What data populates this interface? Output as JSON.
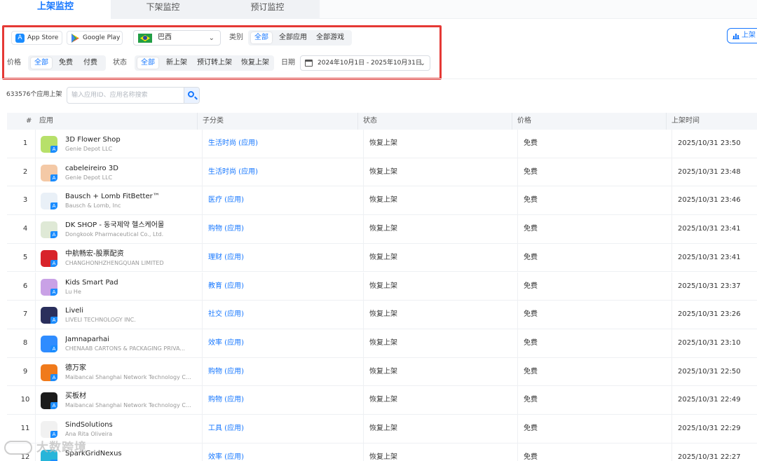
{
  "tabs": [
    {
      "label": "上架监控",
      "active": true
    },
    {
      "label": "下架监控",
      "active": false
    },
    {
      "label": "预订监控",
      "active": false
    }
  ],
  "filters": {
    "stores": [
      {
        "label": "App Store",
        "icon": "app-store-icon"
      },
      {
        "label": "Google Play",
        "icon": "google-play-icon"
      }
    ],
    "country": "巴西",
    "category_label": "类别",
    "category_options": [
      "全部",
      "全部应用",
      "全部游戏"
    ],
    "category_selected": "全部",
    "price_label": "价格",
    "price_options": [
      "全部",
      "免费",
      "付费"
    ],
    "price_selected": "全部",
    "status_label": "状态",
    "status_options": [
      "全部",
      "新上架",
      "预订转上架",
      "恢复上架"
    ],
    "status_selected": "全部",
    "date_label": "日期",
    "date_range": "2024年10月1日 - 2025年10月31日"
  },
  "side_button": "上架",
  "search": {
    "count_text": "633576个应用上架",
    "placeholder": "输入应用ID、应用名称搜索"
  },
  "table": {
    "headers": [
      "#",
      "应用",
      "子分类",
      "状态",
      "价格",
      "上架时间"
    ],
    "rows": [
      {
        "num": "1",
        "name": "3D Flower Shop",
        "dev": "Genie Depot LLC",
        "cat": "生活时尚 (应用)",
        "status": "恢复上架",
        "price": "免费",
        "time": "2025/10/31 23:50",
        "icon_color": "#b7e06a"
      },
      {
        "num": "2",
        "name": "cabeleireiro 3D",
        "dev": "Genie Depot LLC",
        "cat": "生活时尚 (应用)",
        "status": "恢复上架",
        "price": "免费",
        "time": "2025/10/31 23:48",
        "icon_color": "#f4c9a6"
      },
      {
        "num": "3",
        "name": "Bausch + Lomb FitBetter™",
        "dev": "Bausch & Lomb, Inc",
        "cat": "医疗 (应用)",
        "status": "恢复上架",
        "price": "免费",
        "time": "2025/10/31 23:46",
        "icon_color": "#e9f0f7"
      },
      {
        "num": "4",
        "name": "DK SHOP - 동국제약 헬스케어몰",
        "dev": "Dongkook Pharmaceutical Co., Ltd.",
        "cat": "购物 (应用)",
        "status": "恢复上架",
        "price": "免费",
        "time": "2025/10/31 23:41",
        "icon_color": "#dfe9d6"
      },
      {
        "num": "5",
        "name": "中航畅宏-股票配资",
        "dev": "CHANGHONHZHENGQUAN LIMITED",
        "cat": "理财 (应用)",
        "status": "恢复上架",
        "price": "免费",
        "time": "2025/10/31 23:41",
        "icon_color": "#d8232a"
      },
      {
        "num": "6",
        "name": "Kids Smart Pad",
        "dev": "Lu He",
        "cat": "教育 (应用)",
        "status": "恢复上架",
        "price": "免费",
        "time": "2025/10/31 23:37",
        "icon_color": "#c9a1e6"
      },
      {
        "num": "7",
        "name": "Liveli",
        "dev": "LIVELI TECHNOLOGY INC.",
        "cat": "社交 (应用)",
        "status": "恢复上架",
        "price": "免费",
        "time": "2025/10/31 23:26",
        "icon_color": "#2a2f5c"
      },
      {
        "num": "8",
        "name": "Jamnaparhai",
        "dev": "CHENAAB CARTONS & PACKAGING PRIVA...",
        "cat": "效率 (应用)",
        "status": "恢复上架",
        "price": "免费",
        "time": "2025/10/31 23:10",
        "icon_color": "#2f8cff"
      },
      {
        "num": "9",
        "name": "德万家",
        "dev": "Maibancai Shanghai Network Technology Co...",
        "cat": "购物 (应用)",
        "status": "恢复上架",
        "price": "免费",
        "time": "2025/10/31 22:50",
        "icon_color": "#f07a1b"
      },
      {
        "num": "10",
        "name": "买板材",
        "dev": "Maibancai Shanghai Network Technology Co...",
        "cat": "购物 (应用)",
        "status": "恢复上架",
        "price": "免费",
        "time": "2025/10/31 22:49",
        "icon_color": "#1b1b1b"
      },
      {
        "num": "11",
        "name": "SindSolutions",
        "dev": "Ana Rita Oliveira",
        "cat": "工具 (应用)",
        "status": "恢复上架",
        "price": "免费",
        "time": "2025/10/31 22:29",
        "icon_color": "#f1f1f1"
      },
      {
        "num": "12",
        "name": "SparkGridNexus",
        "dev": "",
        "cat": "效率 (应用)",
        "status": "恢复上架",
        "price": "免费",
        "time": "2025/10/31 22:27",
        "icon_color": "#27b5d9"
      }
    ]
  },
  "watermark": "大数跨境"
}
